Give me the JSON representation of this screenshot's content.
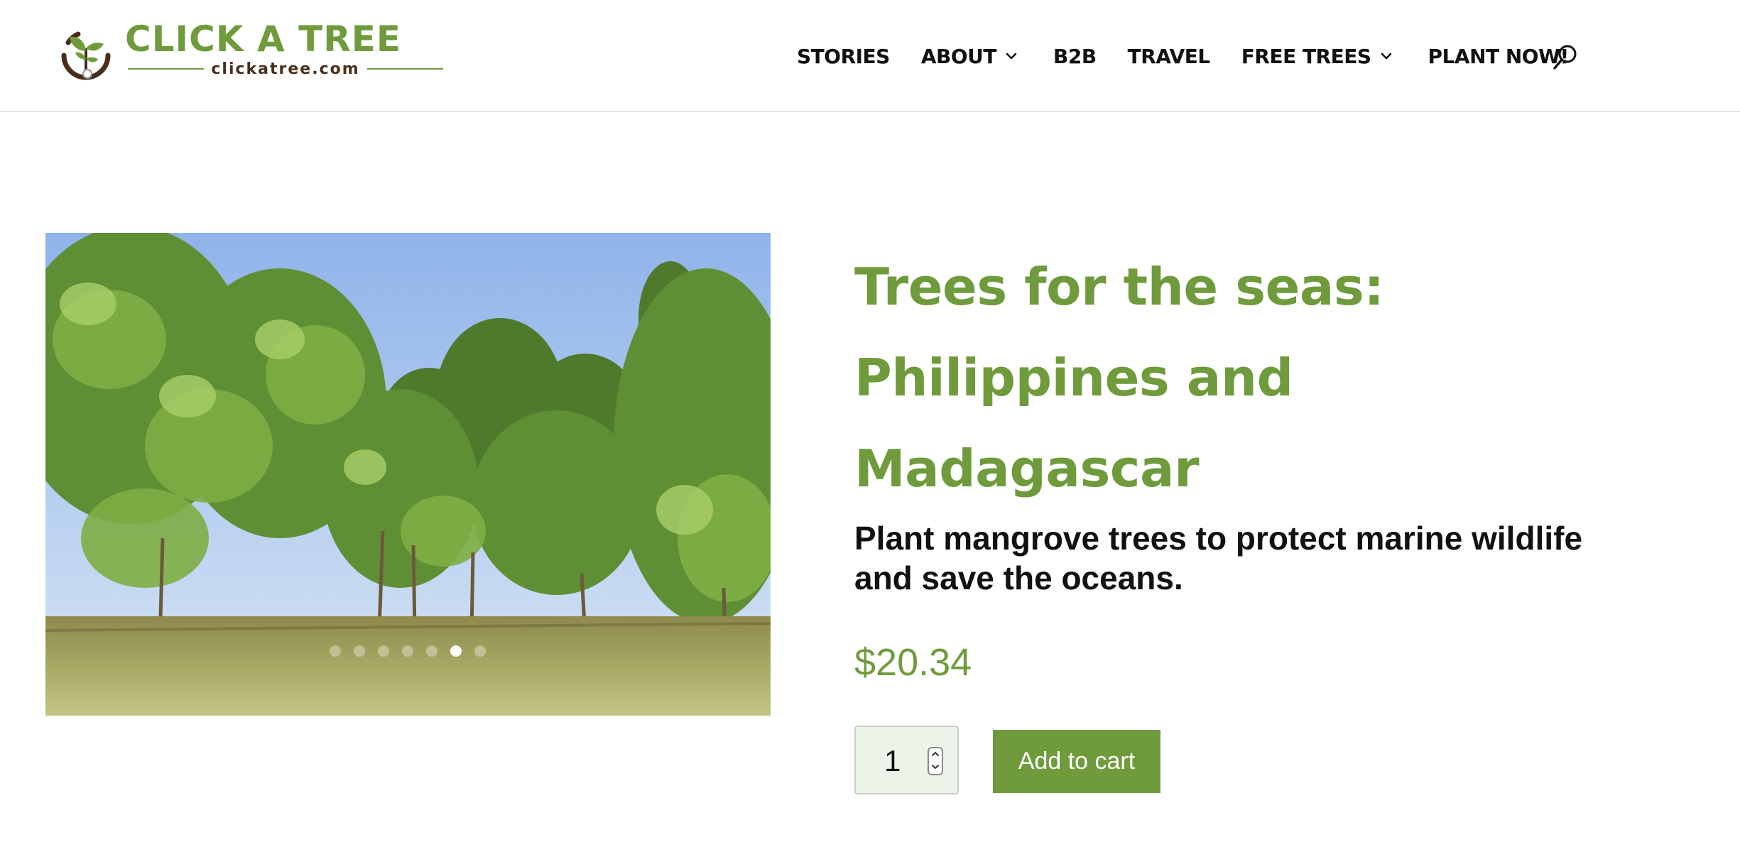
{
  "brand": {
    "name": "CLICK A TREE",
    "domain": "clickatree.com"
  },
  "nav": {
    "items": [
      {
        "label": "STORIES"
      },
      {
        "label": "ABOUT"
      },
      {
        "label": "B2B"
      },
      {
        "label": "TRAVEL"
      },
      {
        "label": "FREE TREES"
      },
      {
        "label": "PLANT NOW!"
      }
    ]
  },
  "product": {
    "title": "Trees for the seas: Philippines and Madagascar",
    "description": "Plant mangrove trees to protect marine wildlife and save the oceans.",
    "price": "$20.34",
    "quantity": "1",
    "add_to_cart_label": "Add to cart"
  },
  "gallery": {
    "slide_count": 7,
    "active_slide": 6
  },
  "colors": {
    "brand_green": "#6f9b3c",
    "text_dark": "#111111",
    "qty_bg": "#ecf4ea"
  },
  "icons": {
    "search": "search-icon",
    "dropdown": "chevron-down-icon",
    "logo_mark": "tree-logo-icon"
  }
}
